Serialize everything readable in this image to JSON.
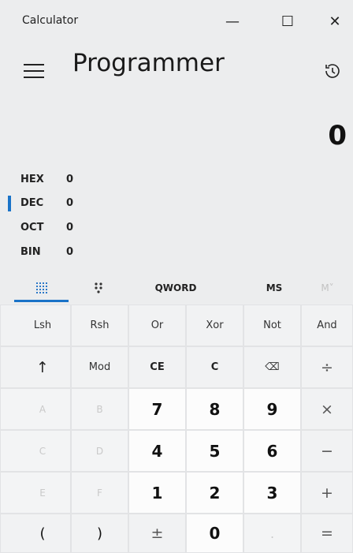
{
  "app_title": "Calculator",
  "window_controls": {
    "minimize": "—",
    "maximize": "☐",
    "close": "✕"
  },
  "mode_title": "Programmer",
  "display_value": "0",
  "radix": [
    {
      "label": "HEX",
      "value": "0",
      "selected": false
    },
    {
      "label": "DEC",
      "value": "0",
      "selected": true
    },
    {
      "label": "OCT",
      "value": "0",
      "selected": false
    },
    {
      "label": "BIN",
      "value": "0",
      "selected": false
    }
  ],
  "toolbar": {
    "word_size": "QWORD",
    "ms": "MS",
    "mr": "M˅"
  },
  "keys": [
    [
      "Lsh",
      "Rsh",
      "Or",
      "Xor",
      "Not",
      "And"
    ],
    [
      "↑",
      "Mod",
      "CE",
      "C",
      "⌫",
      "÷"
    ],
    [
      "A",
      "B",
      "7",
      "8",
      "9",
      "×"
    ],
    [
      "C",
      "D",
      "4",
      "5",
      "6",
      "−"
    ],
    [
      "E",
      "F",
      "1",
      "2",
      "3",
      "+"
    ],
    [
      "(",
      ")",
      "±",
      "0",
      ".",
      "="
    ]
  ],
  "accent_color": "#1a73c8",
  "icons": {
    "menu": "hamburger-icon",
    "history": "history-icon",
    "keypad": "keypad-icon",
    "bit_toggle": "bit-toggle-icon"
  }
}
